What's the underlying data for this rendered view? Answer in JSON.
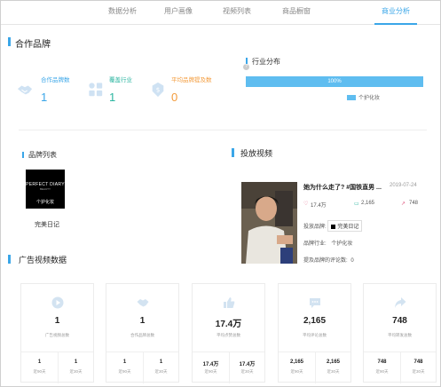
{
  "tabs": [
    {
      "label": "数据分析"
    },
    {
      "label": "用户画像"
    },
    {
      "label": "视频列表"
    },
    {
      "label": "商品橱窗"
    },
    {
      "label": "商业分析"
    }
  ],
  "active_tab": "商业分析",
  "cooperation": {
    "title": "合作品牌",
    "stats": [
      {
        "label": "合作品牌数",
        "value": "1",
        "color": "#3aa6e8",
        "icon": "handshake-icon"
      },
      {
        "label": "覆盖行业",
        "value": "1",
        "color": "#2bb5a0",
        "icon": "grid-icon"
      },
      {
        "label": "平均品牌提及数",
        "value": "0",
        "color": "#f39b3b",
        "icon": "badge-icon"
      }
    ]
  },
  "industry": {
    "title": "行业分布",
    "help": "?",
    "bar_label": "100%",
    "bar_value": 1.0,
    "legend": "个护化妆",
    "color": "#5fbdf0"
  },
  "brand_list": {
    "title": "品牌列表",
    "brand_name": "完美日记",
    "logo_line1": "PERFECT DIARY",
    "logo_line2": "BEAUTY",
    "logo_caption": "个护化妆"
  },
  "video": {
    "title": "投放视频",
    "video_title": "她为什么走了? #国铁直男 ...",
    "date": "2019-07-24",
    "likes": "17.4万",
    "comments": "2,165",
    "shares": "748",
    "brand_label": "投放品牌:",
    "brand_tag": "完美日记",
    "industry_label": "品牌行业:",
    "industry_value": "个护化妆",
    "mention_label": "提及品牌的评论数:",
    "mention_value": "0"
  },
  "ad_data": {
    "title": "广告视频数据",
    "cards": [
      {
        "icon": "play-icon",
        "value": "1",
        "caption": "广告视频总数",
        "a": "1",
        "a_label": "近90天",
        "b": "1",
        "b_label": "近30天"
      },
      {
        "icon": "handshake-icon",
        "value": "1",
        "caption": "合作品牌总数",
        "a": "1",
        "a_label": "近90天",
        "b": "1",
        "b_label": "近30天"
      },
      {
        "icon": "thumbs-up-icon",
        "value": "17.4万",
        "caption": "平均点赞总数",
        "a": "17.4万",
        "a_label": "近90天",
        "b": "17.4万",
        "b_label": "近30天"
      },
      {
        "icon": "comment-icon",
        "value": "2,165",
        "caption": "平均评论总数",
        "a": "2,165",
        "a_label": "近90天",
        "b": "2,165",
        "b_label": "近30天"
      },
      {
        "icon": "share-icon",
        "value": "748",
        "caption": "平均转发总数",
        "a": "748",
        "a_label": "近90天",
        "b": "748",
        "b_label": "近30天"
      }
    ]
  }
}
